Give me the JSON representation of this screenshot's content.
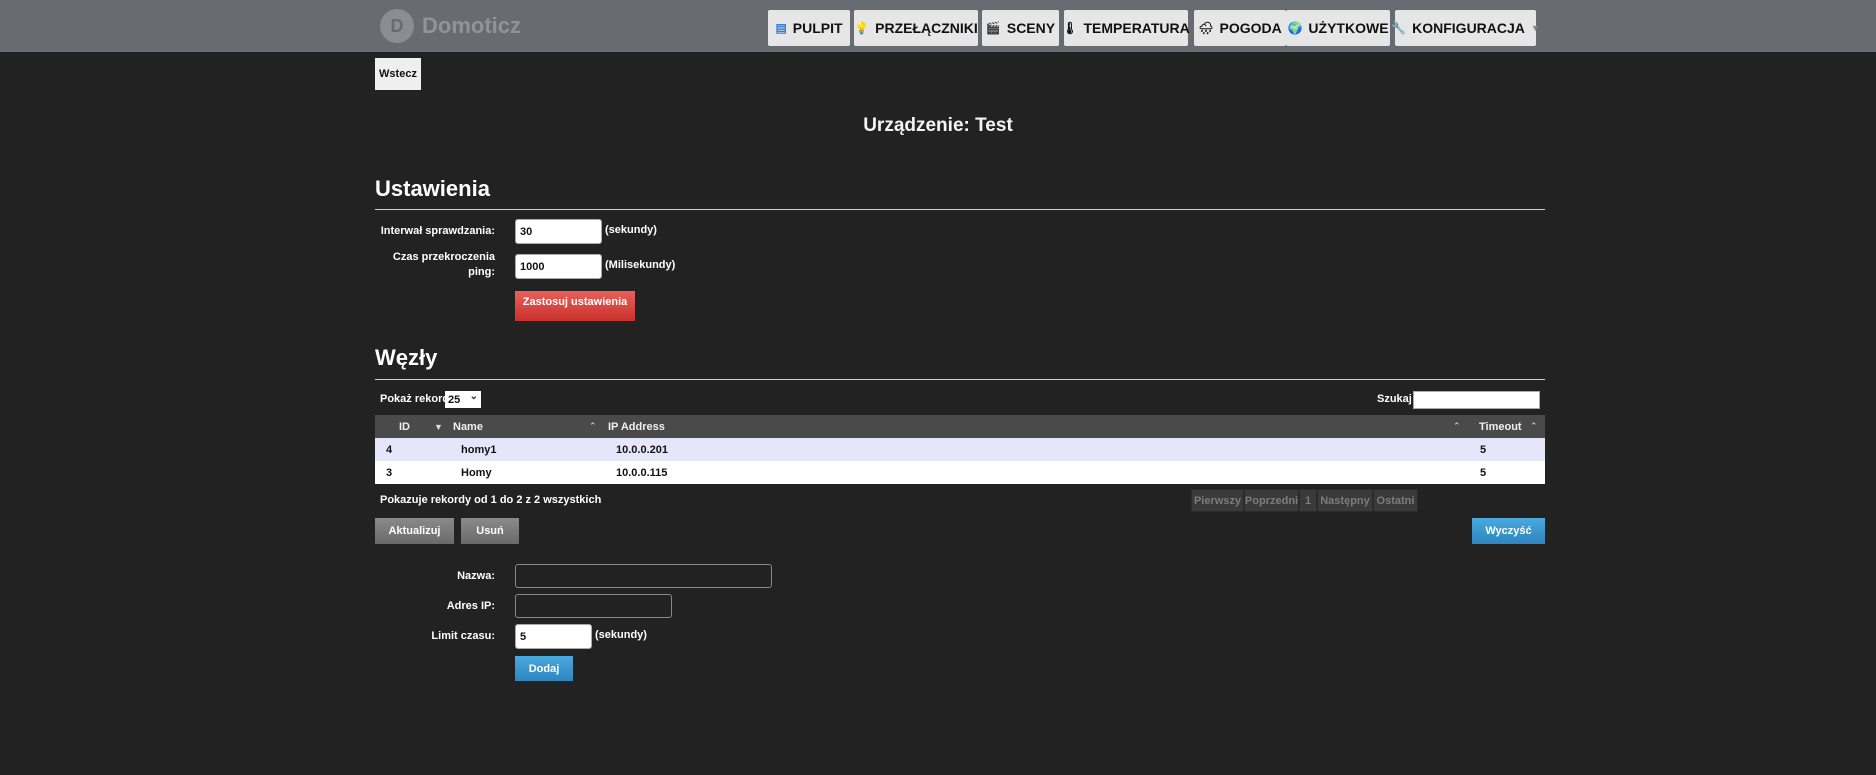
{
  "app": {
    "logo_text": "Domoticz",
    "logo_letter": "D"
  },
  "nav": [
    {
      "label": "PULPIT",
      "icon": "dashboard-icon",
      "glyph": "▤"
    },
    {
      "label": "PRZEŁĄCZNIKI",
      "icon": "lightbulb-icon",
      "glyph": "💡"
    },
    {
      "label": "SCENY",
      "icon": "clapperboard-icon",
      "glyph": "🎬"
    },
    {
      "label": "TEMPERATURA",
      "icon": "thermometer-icon",
      "glyph": "🌡"
    },
    {
      "label": "POGODA",
      "icon": "cloud-rain-icon",
      "glyph": "🌧"
    },
    {
      "label": "UŻYTKOWE",
      "icon": "globe-icon",
      "glyph": "🌍"
    },
    {
      "label": "KONFIGURACJA",
      "icon": "wrench-icon",
      "glyph": "🔧"
    }
  ],
  "back_label": "Wstecz",
  "device_title": "Urządzenie: Test",
  "settings": {
    "title": "Ustawienia",
    "interval_label": "Interwał sprawdzania:",
    "interval_value": "30",
    "interval_unit": "(sekundy)",
    "timeout_label_1": "Czas przekroczenia",
    "timeout_label_2": "ping:",
    "timeout_value": "1000",
    "timeout_unit": "(Milisekundy)",
    "apply_label": "Zastosuj ustawienia"
  },
  "nodes": {
    "title": "Węzły",
    "show_label": "Pokaż rekordy",
    "show_value": "25",
    "search_label": "Szukaj :",
    "columns": [
      "ID",
      "Name",
      "IP Address",
      "Timeout"
    ],
    "rows": [
      {
        "id": "4",
        "name": "homy1",
        "ip": "10.0.0.201",
        "timeout": "5"
      },
      {
        "id": "3",
        "name": "Homy",
        "ip": "10.0.0.115",
        "timeout": "5"
      }
    ],
    "info": "Pokazuje rekordy od 1 do 2 z 2 wszystkich",
    "pager": {
      "first": "Pierwszy",
      "prev": "Poprzedni",
      "page": "1",
      "next": "Następny",
      "last": "Ostatni"
    },
    "update_label": "Aktualizuj",
    "delete_label": "Usuń",
    "clear_label": "Wyczyść"
  },
  "add_form": {
    "name_label": "Nazwa:",
    "ip_label": "Adres IP:",
    "timeout_label": "Limit czasu:",
    "timeout_value": "5",
    "timeout_unit": "(sekundy)",
    "add_label": "Dodaj"
  }
}
